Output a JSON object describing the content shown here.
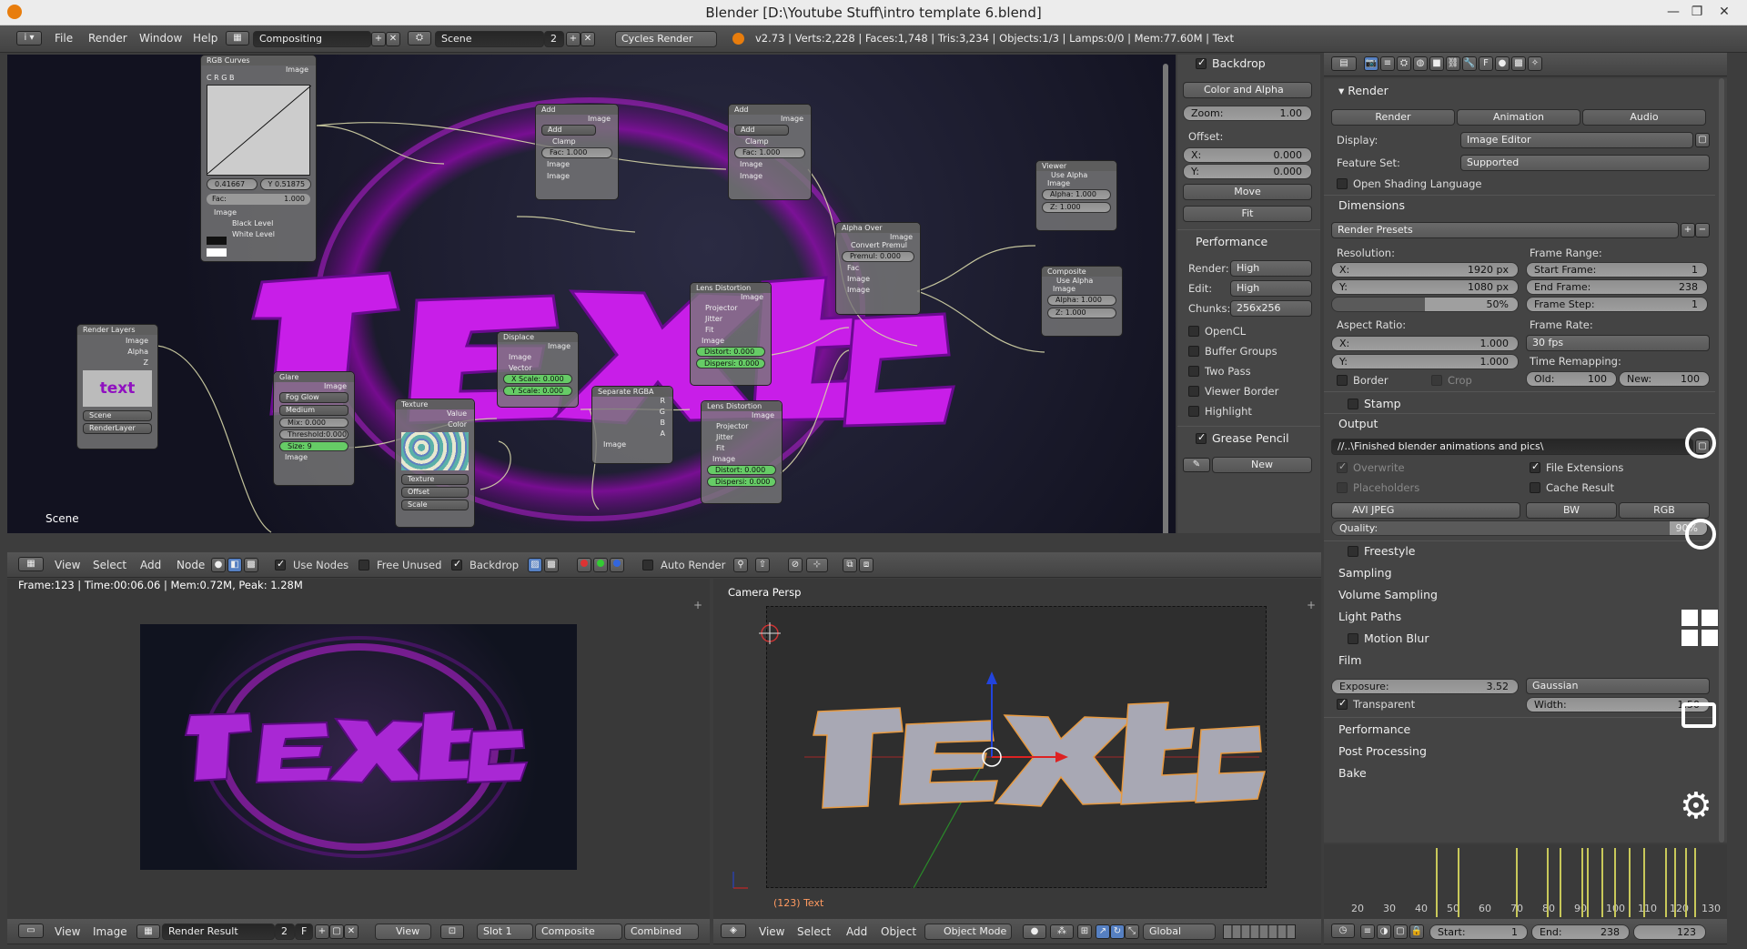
{
  "title": "Blender [D:\\Youtube Stuff\\intro template 6.blend]",
  "top_menu": [
    "File",
    "Render",
    "Window",
    "Help"
  ],
  "workspace": "Compositing",
  "scene": "Scene",
  "scene_users": "2",
  "engine": "Cycles Render",
  "stats": "v2.73 | Verts:2,228 | Faces:1,748 | Tris:3,234 | Objects:1/3 | Lamps:0/0 | Mem:77.60M | Text",
  "node_editor": {
    "scene_label": "Scene",
    "scene_text": "text",
    "nodes": {
      "rgb_curves": {
        "title": "RGB Curves",
        "out": "Image",
        "channels": "C R G B",
        "x": "0.41667",
        "y": "Y 0.51875",
        "fac": "Fac:",
        "fac_val": "1.000",
        "image": "Image",
        "black": "Black Level",
        "white": "White Level"
      },
      "add1": {
        "title": "Add",
        "out": "Image",
        "mode": "Add",
        "clamp": "Clamp",
        "fac": "Fac:",
        "fac_val": "1.000",
        "in1": "Image",
        "in2": "Image"
      },
      "add2": {
        "title": "Add",
        "out": "Image",
        "mode": "Add",
        "clamp": "Clamp",
        "fac": "Fac:",
        "fac_val": "1.000",
        "in1": "Image",
        "in2": "Image"
      },
      "viewer": {
        "title": "Viewer",
        "alpha_cb": "Use Alpha",
        "image": "Image",
        "alpha": "Alpha:",
        "alpha_val": "1.000",
        "z": "Z:",
        "z_val": "1.000"
      },
      "composite": {
        "title": "Composite",
        "alpha_cb": "Use Alpha",
        "image": "Image",
        "alpha": "Alpha:",
        "alpha_val": "1.000",
        "z": "Z:",
        "z_val": "1.000"
      },
      "alpha_over": {
        "title": "Alpha Over",
        "out": "Image",
        "convert": "Convert Premul",
        "premul": "Premul:",
        "premul_val": "0.000",
        "fac": "Fac",
        "in1": "Image",
        "in2": "Image"
      },
      "lens1": {
        "title": "Lens Distortion",
        "out": "Image",
        "projector": "Projector",
        "jitter": "Jitter",
        "fit": "Fit",
        "image": "Image",
        "distort": "Distort:",
        "distort_val": "0.000",
        "dispersion": "Dispersi:",
        "dispersion_val": "0.000"
      },
      "lens2": {
        "title": "Lens Distortion",
        "out": "Image",
        "projector": "Projector",
        "jitter": "Jitter",
        "fit": "Fit",
        "image": "Image",
        "distort": "Distort:",
        "distort_val": "0.000",
        "dispersion": "Dispersi:",
        "dispersion_val": "0.000"
      },
      "displace": {
        "title": "Displace",
        "out": "Image",
        "image": "Image",
        "vector": "Vector",
        "xscale": "X Scale:",
        "xscale_val": "0.000",
        "yscale": "Y Scale:",
        "yscale_val": "0.000"
      },
      "separate": {
        "title": "Separate RGBA",
        "r": "R",
        "g": "G",
        "b": "B",
        "a": "A",
        "image": "Image"
      },
      "render_layers": {
        "title": "Render Layers",
        "image": "Image",
        "alpha": "Alpha",
        "z": "Z",
        "scene": "Scene",
        "layer": "RenderLayer"
      },
      "glare": {
        "title": "Glare",
        "out": "Image",
        "type": "Fog Glow",
        "quality": "Medium",
        "mix": "Mix:",
        "mix_val": "0.000",
        "threshold": "Threshold:",
        "threshold_val": "0.000",
        "size": "Size:",
        "size_val": "9",
        "image": "Image"
      },
      "texture": {
        "title": "Texture",
        "value": "Value",
        "color": "Color",
        "tex": "Texture",
        "offset": "Offset",
        "scale": "Scale"
      }
    }
  },
  "node_header": {
    "menus": [
      "View",
      "Select",
      "Add",
      "Node"
    ],
    "use_nodes": "Use Nodes",
    "free_unused": "Free Unused",
    "backdrop": "Backdrop",
    "auto_render": "Auto Render"
  },
  "backdrop_panel": {
    "header": "Backdrop",
    "mode": "Color and Alpha",
    "zoom": "Zoom:",
    "zoom_val": "1.00",
    "offset": "Offset:",
    "x": "X:",
    "x_val": "0.000",
    "y": "Y:",
    "y_val": "0.000",
    "move": "Move",
    "fit": "Fit"
  },
  "performance_panel": {
    "header": "Performance",
    "render": "Render:",
    "render_val": "High",
    "edit": "Edit:",
    "edit_val": "High",
    "chunks": "Chunks:",
    "chunks_val": "256x256",
    "opencl": "OpenCL",
    "buffer": "Buffer Groups",
    "twopass": "Two Pass",
    "viewer_border": "Viewer Border",
    "highlight": "Highlight"
  },
  "grease_panel": {
    "header": "Grease Pencil",
    "new": "New"
  },
  "image_editor": {
    "frame_info": "Frame:123 | Time:00:06.06 | Mem:0.72M, Peak: 1.28M",
    "text": "text",
    "menus": [
      "View",
      "Image"
    ],
    "image": "Render Result",
    "users": "2",
    "f": "F",
    "view": "View",
    "slot": "Slot 1",
    "layer": "Composite",
    "pass": "Combined"
  },
  "viewport": {
    "label": "Camera Persp",
    "object": "(123) Text",
    "text": "text",
    "menus": [
      "View",
      "Select",
      "Add",
      "Object"
    ],
    "mode": "Object Mode",
    "orientation": "Global"
  },
  "properties": {
    "render_header": "Render",
    "render_btn": "Render",
    "anim_btn": "Animation",
    "audio_btn": "Audio",
    "display": "Display:",
    "display_val": "Image Editor",
    "feature": "Feature Set:",
    "feature_val": "Supported",
    "osl": "Open Shading Language",
    "dimensions": "Dimensions",
    "presets": "Render Presets",
    "resolution": "Resolution:",
    "res_x": "X:",
    "res_x_val": "1920 px",
    "res_y": "Y:",
    "res_y_val": "1080 px",
    "res_pct": "50%",
    "frame_range": "Frame Range:",
    "start": "Start Frame:",
    "start_val": "1",
    "end": "End Frame:",
    "end_val": "238",
    "step": "Frame Step:",
    "step_val": "1",
    "aspect": "Aspect Ratio:",
    "asp_x": "X:",
    "asp_x_val": "1.000",
    "asp_y": "Y:",
    "asp_y_val": "1.000",
    "frame_rate": "Frame Rate:",
    "fps": "30 fps",
    "remap": "Time Remapping:",
    "old": "Old:",
    "old_val": "100",
    "new": "New:",
    "new_val": "100",
    "border": "Border",
    "crop": "Crop",
    "stamp": "Stamp",
    "output": "Output",
    "path": "//..\\Finished blender animations and pics\\",
    "overwrite": "Overwrite",
    "file_ext": "File Extensions",
    "placeholders": "Placeholders",
    "cache": "Cache Result",
    "format": "AVI JPEG",
    "bw": "BW",
    "rgb": "RGB",
    "quality": "Quality:",
    "quality_val": "90%",
    "freestyle": "Freestyle",
    "sampling": "Sampling",
    "volume": "Volume Sampling",
    "light": "Light Paths",
    "motion": "Motion Blur",
    "film": "Film",
    "exposure": "Exposure:",
    "exposure_val": "3.52",
    "filter": "Gaussian",
    "transparent": "Transparent",
    "width": "Width:",
    "width_val": "1.50",
    "performance": "Performance",
    "post": "Post Processing",
    "bake": "Bake"
  },
  "timeline": {
    "ticks": [
      "20",
      "30",
      "40",
      "50",
      "60",
      "70",
      "80",
      "90",
      "100",
      "110",
      "120",
      "130"
    ],
    "start": "Start:",
    "start_val": "1",
    "end": "End:",
    "end_val": "238",
    "current": "123"
  }
}
